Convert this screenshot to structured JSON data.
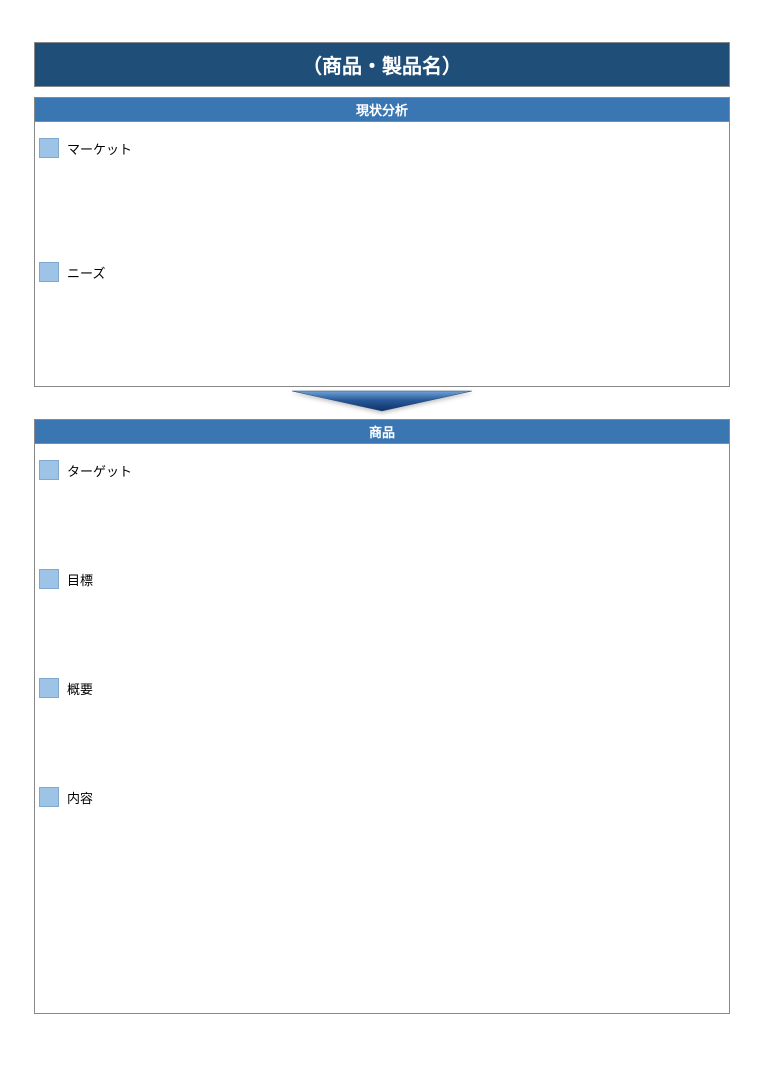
{
  "title": "（商品・製品名）",
  "analysis": {
    "header": "現状分析",
    "items": [
      {
        "label": "マーケット"
      },
      {
        "label": "ニーズ"
      }
    ]
  },
  "product": {
    "header": "商品",
    "items": [
      {
        "label": "ターゲット"
      },
      {
        "label": "目標"
      },
      {
        "label": "概要"
      },
      {
        "label": "内容"
      }
    ]
  }
}
